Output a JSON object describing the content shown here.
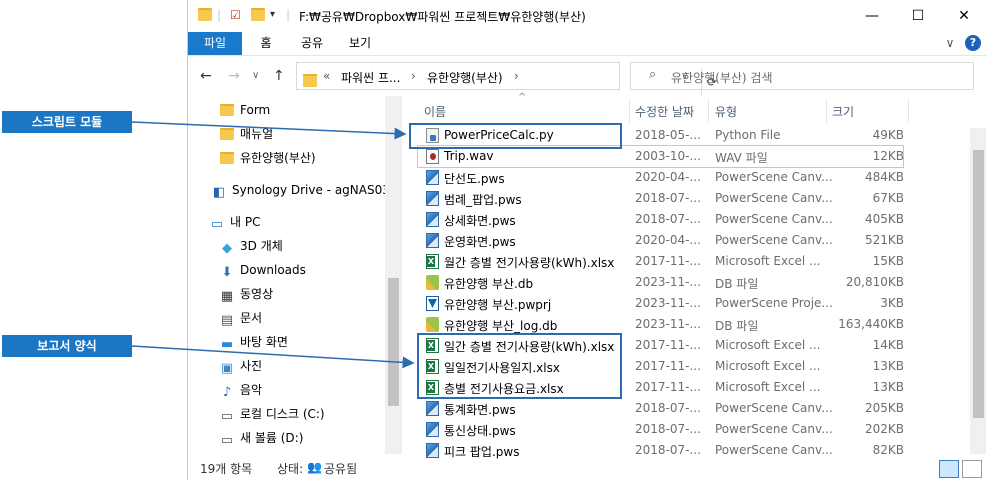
{
  "window": {
    "title": "F:₩공유₩Dropbox₩파워씬 프로젝트₩유한양행(부산)",
    "minimize": "—",
    "maximize": "☐",
    "close": "✕"
  },
  "ribbon": {
    "tabs": [
      "파일",
      "홈",
      "공유",
      "보기"
    ],
    "expand": "∨",
    "help": "?"
  },
  "address": {
    "back": "←",
    "forward": "→",
    "up": "↑",
    "chevron": "∨",
    "overflow": "«",
    "crumb1": "파워씬 프...",
    "crumb2": "유한양행(부산)",
    "sep": "›",
    "refresh": "⟳"
  },
  "search": {
    "placeholder": "유한양행(부산) 검색",
    "icon": "search-icon"
  },
  "nav": {
    "items": [
      {
        "label": "Form",
        "icon": "folder-icon"
      },
      {
        "label": "매뉴얼",
        "icon": "folder-icon"
      },
      {
        "label": "유한양행(부산)",
        "icon": "folder-icon"
      },
      {
        "label": "Synology Drive - agNAS03",
        "icon": "synology-icon"
      },
      {
        "label": "내 PC",
        "icon": "pc-icon"
      },
      {
        "label": "3D 개체",
        "icon": "3d-objects-icon"
      },
      {
        "label": "Downloads",
        "icon": "download-icon"
      },
      {
        "label": "동영상",
        "icon": "video-icon"
      },
      {
        "label": "문서",
        "icon": "documents-icon"
      },
      {
        "label": "바탕 화면",
        "icon": "desktop-icon"
      },
      {
        "label": "사진",
        "icon": "pictures-icon"
      },
      {
        "label": "음악",
        "icon": "music-icon"
      },
      {
        "label": "로컬 디스크 (C:)",
        "icon": "drive-icon"
      },
      {
        "label": "새 볼륨 (D:)",
        "icon": "drive-icon"
      }
    ]
  },
  "columns": {
    "name": "이름",
    "modified": "수정한 날짜",
    "type": "유형",
    "size": "크기"
  },
  "files": [
    {
      "name": "PowerPriceCalc.py",
      "date": "2018-05-...",
      "type": "Python File",
      "size": "49KB",
      "kind": "py"
    },
    {
      "name": "Trip.wav",
      "date": "2003-10-...",
      "type": "WAV 파일",
      "size": "12KB",
      "kind": "wav"
    },
    {
      "name": "단선도.pws",
      "date": "2020-04-...",
      "type": "PowerScene Canv...",
      "size": "484KB",
      "kind": "pws"
    },
    {
      "name": "범례_팝업.pws",
      "date": "2018-07-...",
      "type": "PowerScene Canv...",
      "size": "67KB",
      "kind": "pws"
    },
    {
      "name": "상세화면.pws",
      "date": "2018-07-...",
      "type": "PowerScene Canv...",
      "size": "405KB",
      "kind": "pws"
    },
    {
      "name": "운영화면.pws",
      "date": "2020-04-...",
      "type": "PowerScene Canv...",
      "size": "521KB",
      "kind": "pws"
    },
    {
      "name": "월간 층별 전기사용량(kWh).xlsx",
      "date": "2017-11-...",
      "type": "Microsoft Excel ...",
      "size": "15KB",
      "kind": "xls"
    },
    {
      "name": "유한양행 부산.db",
      "date": "2023-11-...",
      "type": "DB 파일",
      "size": "20,810KB",
      "kind": "db"
    },
    {
      "name": "유한양행 부산.pwprj",
      "date": "2023-11-...",
      "type": "PowerScene Proje...",
      "size": "3KB",
      "kind": "proj"
    },
    {
      "name": "유한양행 부산_log.db",
      "date": "2023-11-...",
      "type": "DB 파일",
      "size": "163,440KB",
      "kind": "db"
    },
    {
      "name": "일간 층별 전기사용량(kWh).xlsx",
      "date": "2017-11-...",
      "type": "Microsoft Excel ...",
      "size": "14KB",
      "kind": "xls"
    },
    {
      "name": "일일전기사용일지.xlsx",
      "date": "2017-11-...",
      "type": "Microsoft Excel ...",
      "size": "13KB",
      "kind": "xls"
    },
    {
      "name": "층별 전기사용요금.xlsx",
      "date": "2017-11-...",
      "type": "Microsoft Excel ...",
      "size": "13KB",
      "kind": "xls"
    },
    {
      "name": "통계화면.pws",
      "date": "2018-07-...",
      "type": "PowerScene Canv...",
      "size": "205KB",
      "kind": "pws"
    },
    {
      "name": "통신상태.pws",
      "date": "2018-07-...",
      "type": "PowerScene Canv...",
      "size": "202KB",
      "kind": "pws"
    },
    {
      "name": "피크 팝업.pws",
      "date": "2018-07-...",
      "type": "PowerScene Canv...",
      "size": "82KB",
      "kind": "pws"
    }
  ],
  "status": {
    "count": "19개 항목",
    "state_label": "상태:",
    "state_value": "공유됨"
  },
  "annotations": {
    "script_module": "스크립트 모듈",
    "report_form": "보고서 양식"
  },
  "colors": {
    "accent": "#1979ca",
    "callout": "#1b77c3",
    "annotation_border": "#2b6cb0"
  }
}
